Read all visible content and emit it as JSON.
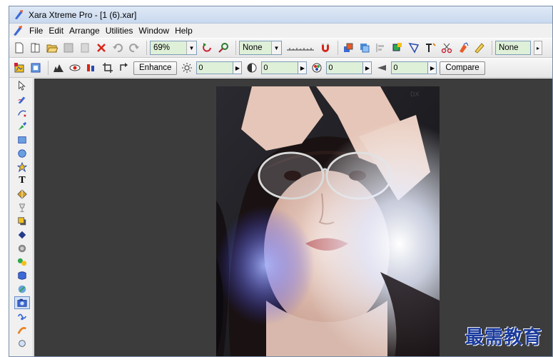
{
  "window": {
    "title": "Xara Xtreme Pro - [1 (6).xar]"
  },
  "menu": [
    "File",
    "Edit",
    "Arrange",
    "Utilities",
    "Window",
    "Help"
  ],
  "toolbar": {
    "zoom_value": "69%",
    "quality_value": "None",
    "right_combo_value": "None"
  },
  "bitmap_bar": {
    "enhance_label": "Enhance",
    "brightness_value": "0",
    "contrast_value": "0",
    "saturation_value": "0",
    "sharpen_value": "0",
    "compare_label": "Compare"
  },
  "photo": {
    "logo_text": "DX"
  },
  "watermark": "最需教育",
  "colors": {
    "canvas": "#3c3c3c",
    "field": "#dff0d8",
    "watermark": "#1a3a9c"
  }
}
